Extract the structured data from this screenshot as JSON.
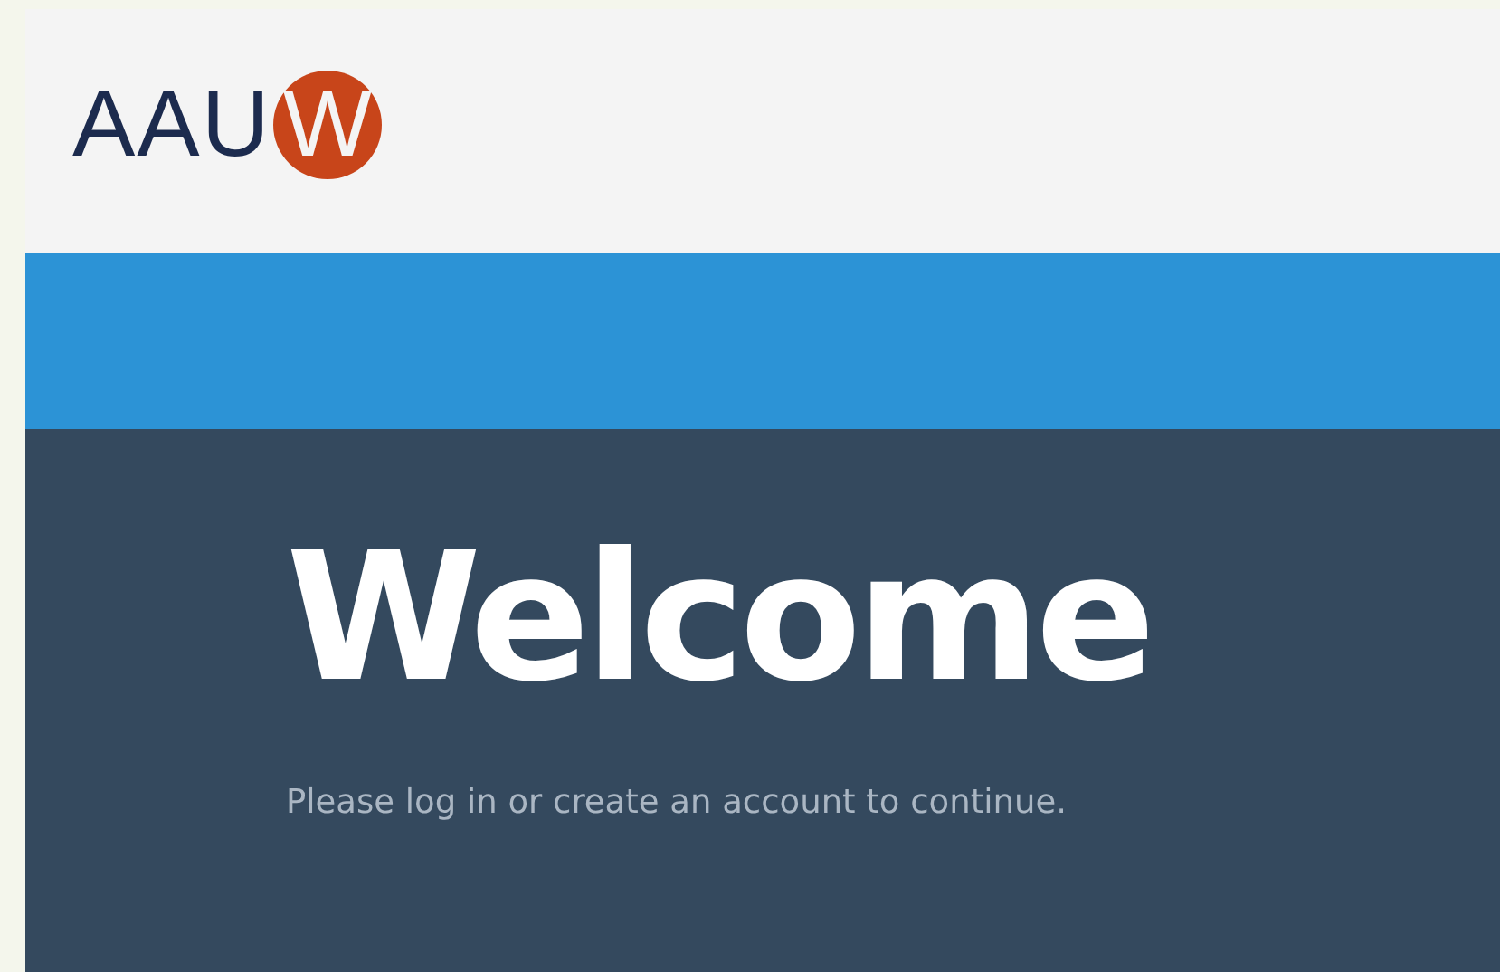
{
  "header": {
    "logo": {
      "text": "AAU",
      "badge": "W"
    }
  },
  "hero": {
    "title": "Welcome",
    "subtitle": "Please log in or create an account to continue."
  }
}
